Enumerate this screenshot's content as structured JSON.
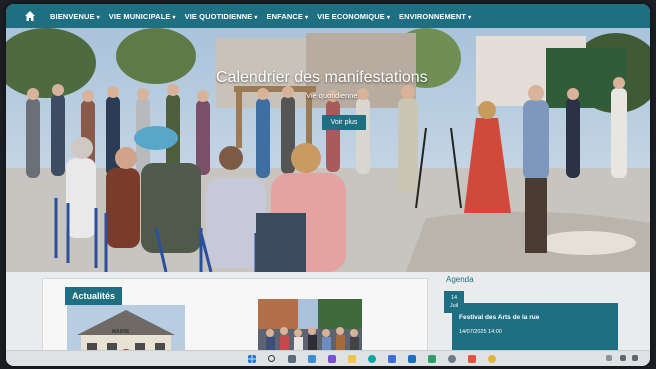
{
  "nav": {
    "items": [
      {
        "label": "BIENVENUE",
        "caret": "▾"
      },
      {
        "label": "VIE MUNICIPALE",
        "caret": "▾"
      },
      {
        "label": "VIE QUOTIDIENNE",
        "caret": "▾"
      },
      {
        "label": "ENFANCE",
        "caret": "▾"
      },
      {
        "label": "VIE ECONOMIQUE",
        "caret": "▾"
      },
      {
        "label": "ENVIRONNEMENT",
        "caret": "▾"
      }
    ]
  },
  "hero": {
    "title": "Calendrier des manifestations",
    "subtitle": "Vie quotidienne",
    "button": "Voir plus"
  },
  "news": {
    "title": "Actualités",
    "sign_text": "MAIRIE"
  },
  "agenda": {
    "title": "Agenda",
    "day": "14",
    "month": "Juil",
    "event_title": "Festival des Arts de la rue",
    "event_date": "14/07/2025 14:00"
  },
  "colors": {
    "accent": "#1f6f83"
  },
  "icons": {
    "home": "home-icon"
  }
}
